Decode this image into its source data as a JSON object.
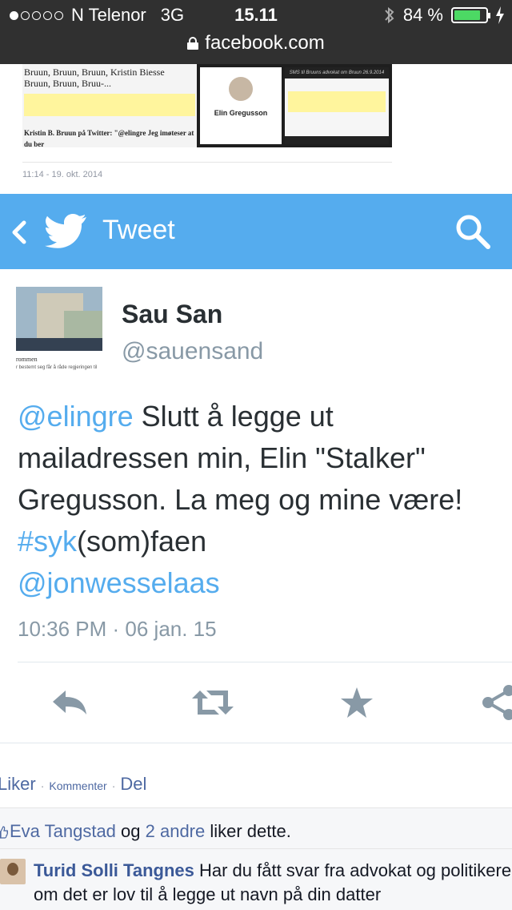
{
  "status_bar": {
    "carrier": "N Telenor",
    "network": "3G",
    "time": "15.11",
    "battery": "84 %",
    "battery_level": 0.84,
    "url": "facebook.com"
  },
  "embedded_image": {
    "names_line1": "Bruun, Bruun, Bruun, Kristin Biesse",
    "names_line2": "Bruun, Bruun, Bruu-...",
    "twitter_line": "Kristin B. Bruun på Twitter: \"@elingre Jeg imøteser at du ber",
    "person_name": "Elin Gregusson",
    "header_caption": "SMS til Bruuns advokat om Bruun 26.9.2014"
  },
  "fb_post_time": "11:14 - 19. okt. 2014",
  "twitter_header": {
    "title": "Tweet"
  },
  "tweet": {
    "avatar_caption": "rommen",
    "avatar_subcaption": "r bestemt seg får å råde regjeringen til",
    "name": "Sau San",
    "handle": "@sauensand",
    "mention": "@elingre",
    "text_1": " Slutt å legge ut mailadressen min, Elin \"Stalker\" Gregusson. La meg og mine være!",
    "hashtag": "#syk",
    "text_2": "(som)faen",
    "mention_2": "@jonwesselaas",
    "timestamp": "10:36 PM · 06 jan. 15"
  },
  "fb_actions": {
    "like": "Liker",
    "comment": "Kommenter",
    "share": "Del",
    "separator": "·"
  },
  "fb_likes": {
    "user": "Eva Tangstad",
    "and": " og ",
    "others": "2 andre",
    "suffix": " liker dette."
  },
  "fb_comment": {
    "author": "Turid Solli Tangnes",
    "text": " Har du fått svar fra advokat og politikeren om det er lov til å legge ut navn på din datter"
  },
  "colors": {
    "twitter_blue": "#55acee",
    "fb_link": "#4e69a2",
    "battery_green": "#4cd964"
  }
}
